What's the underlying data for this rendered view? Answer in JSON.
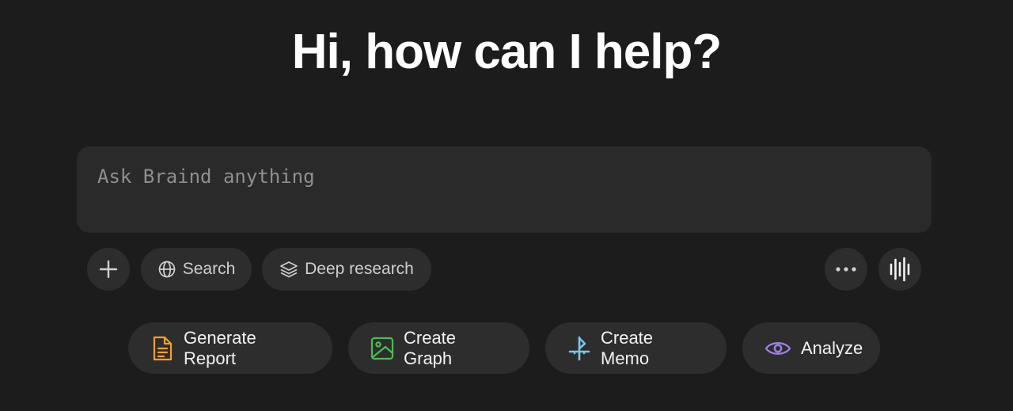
{
  "header": {
    "title": "Hi, how can I help?"
  },
  "prompt": {
    "placeholder": "Ask Braind anything",
    "value": ""
  },
  "toolbar": {
    "add_icon": "plus-icon",
    "search_label": "Search",
    "search_icon": "globe-icon",
    "deep_research_label": "Deep research",
    "deep_research_icon": "layers-icon",
    "more_icon": "ellipsis-icon",
    "voice_icon": "voice-waveform-icon"
  },
  "suggestions": [
    {
      "label": "Generate Report",
      "icon": "document-icon",
      "color": "#f0a033"
    },
    {
      "label": "Create Graph",
      "icon": "image-icon",
      "color": "#4cbb55"
    },
    {
      "label": "Create Memo",
      "icon": "memo-icon",
      "color": "#7cc4ea"
    },
    {
      "label": "Analyze",
      "icon": "eye-icon",
      "color": "#9c7ee3"
    }
  ],
  "colors": {
    "background": "#1c1c1c",
    "panel": "#2a2a2a",
    "button": "#2d2d2d"
  }
}
